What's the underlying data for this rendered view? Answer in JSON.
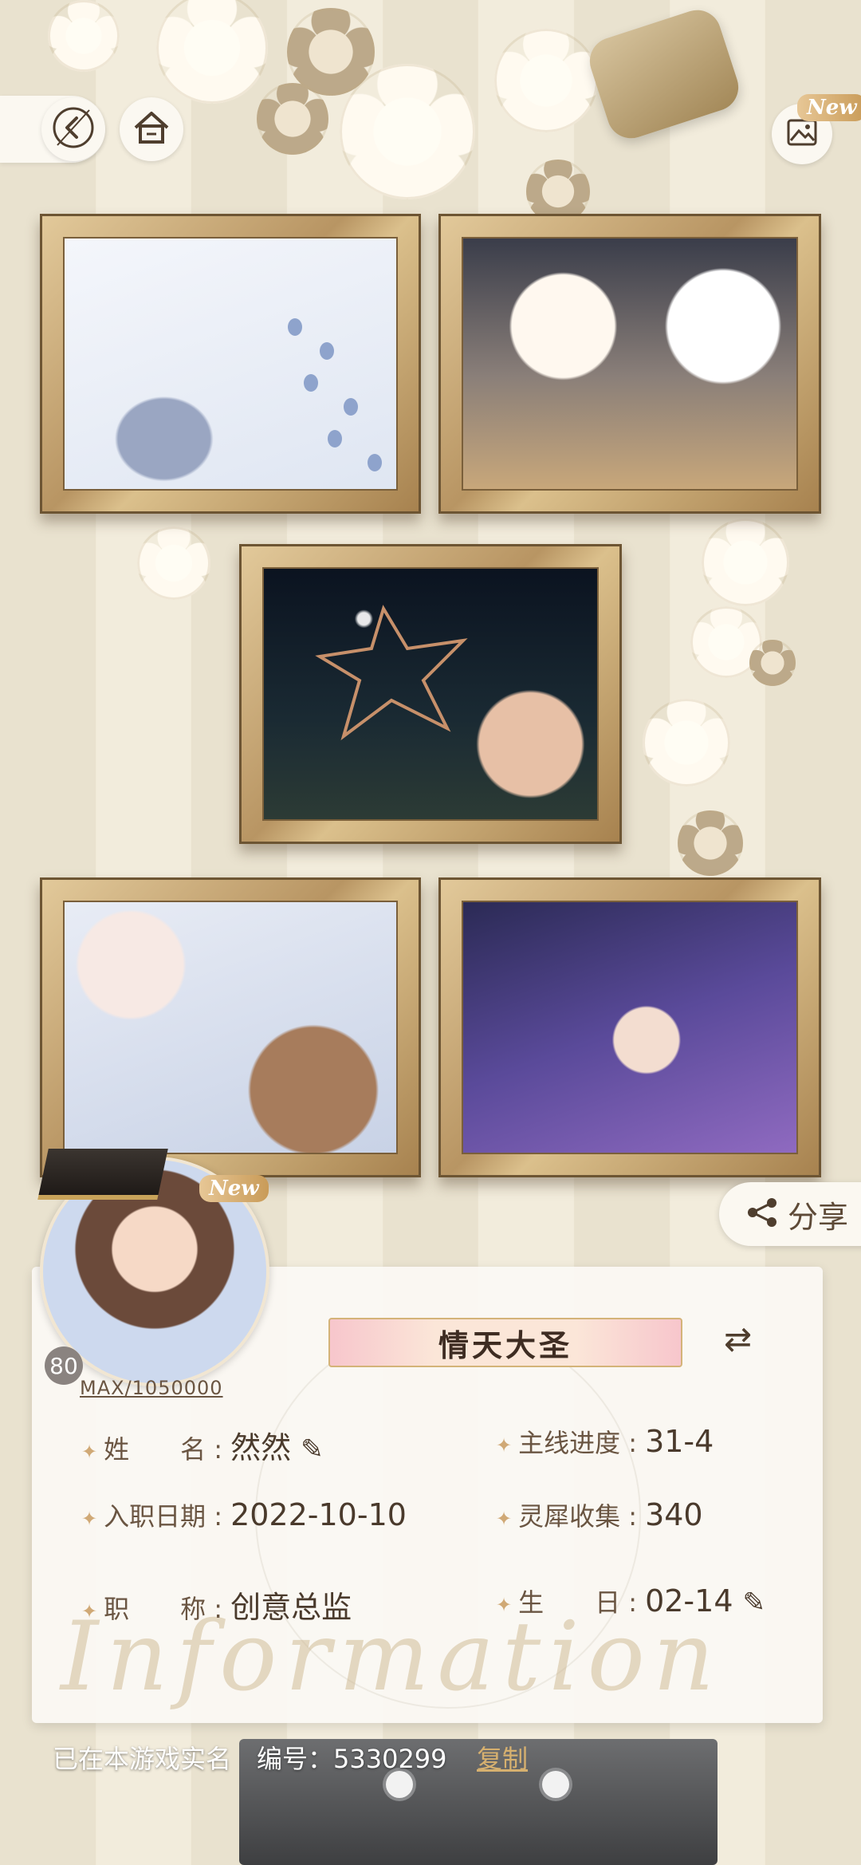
{
  "header": {
    "gallery_new_badge": "New"
  },
  "gallery": {
    "photos": [
      {
        "name": "snow-footprints-photo"
      },
      {
        "name": "cat-drinks-photo"
      },
      {
        "name": "sparkler-star-photo"
      },
      {
        "name": "snowman-gloves-photo"
      },
      {
        "name": "holding-hands-photo"
      }
    ]
  },
  "share": {
    "label": "分享"
  },
  "profile": {
    "avatar_new_badge": "New",
    "level": "80",
    "exp_text": "MAX/1050000",
    "title": "情天大圣",
    "fields": {
      "name_label": "姓　　名 :",
      "name_value": "然然",
      "mainline_label": "主线进度 :",
      "mainline_value": "31-4",
      "join_label": "入职日期 :",
      "join_value": "2022-10-10",
      "collection_label": "灵犀收集 :",
      "collection_value": "340",
      "job_label": "职　　称 :",
      "job_value": "创意总监",
      "birthday_label": "生　　日 :",
      "birthday_value": "02-14"
    },
    "watermark": "Information"
  },
  "footer": {
    "verified_text": "已在本游戏实名　编号：5330299",
    "copy_label": "复制"
  },
  "colors": {
    "accent_gold": "#d6b06f",
    "frame_gold": "#b89563",
    "text_brown": "#5e4a37"
  }
}
